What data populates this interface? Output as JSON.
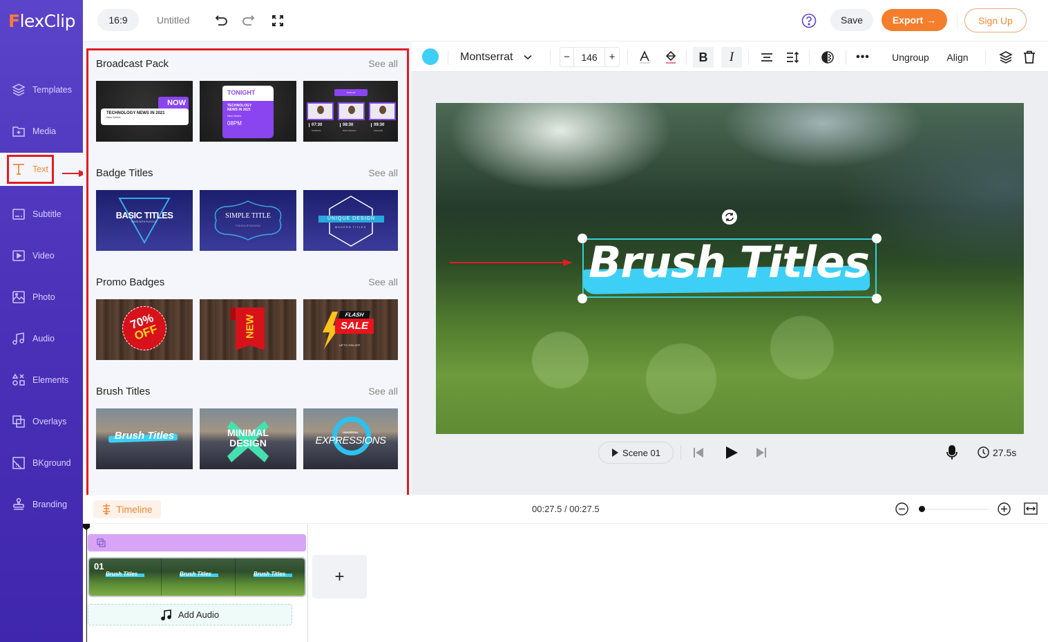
{
  "app": {
    "logo": "FlexClip",
    "aspect_ratio": "16:9",
    "project_title": "Untitled",
    "undo_icon": "undo-icon",
    "redo_icon": "redo-icon",
    "fullscreen_icon": "fullscreen-icon",
    "help_icon": "help-icon",
    "save_label": "Save",
    "export_label": "Export",
    "signup_label": "Sign Up",
    "accent": "#f47e2c",
    "sidebar_color": "#4a31b8"
  },
  "sidebar": {
    "items": [
      {
        "label": "Templates",
        "icon": "layers-icon"
      },
      {
        "label": "Media",
        "icon": "folder-plus-icon"
      },
      {
        "label": "Text",
        "icon": "text-icon",
        "active": true
      },
      {
        "label": "Subtitle",
        "icon": "subtitle-icon"
      },
      {
        "label": "Video",
        "icon": "video-icon"
      },
      {
        "label": "Photo",
        "icon": "photo-icon"
      },
      {
        "label": "Audio",
        "icon": "music-icon"
      },
      {
        "label": "Elements",
        "icon": "shapes-icon"
      },
      {
        "label": "Overlays",
        "icon": "overlays-icon"
      },
      {
        "label": "BKground",
        "icon": "background-icon"
      },
      {
        "label": "Branding",
        "icon": "stamp-icon"
      }
    ]
  },
  "panel": {
    "see_all": "See all",
    "sections": [
      {
        "title": "Broadcast Pack",
        "thumbs": [
          {
            "main": "TECHNOLOGY NEWS IN 2021",
            "sub": "New Series",
            "badge": "NOW"
          },
          {
            "head": "TONIGHT",
            "main": "TECHNOLOGY NEWS IN 2021",
            "sub": "New Series",
            "time": "08PM"
          },
          {
            "head": "TONIGHT",
            "times": [
              "07:30",
              "08:30",
              "09:30"
            ],
            "labels": [
              "SCIENCE",
              "WILD WORLD",
              "FASHION"
            ]
          }
        ]
      },
      {
        "title": "Badge Titles",
        "thumbs": [
          {
            "main": "BASIC TITLES",
            "sub": "MADE WITH FLEXCLIP"
          },
          {
            "main": "SIMPLE TITLE",
            "sub": "FLEXCLIP DESIGN"
          },
          {
            "main": "UNIQUE DESIGN",
            "sub": "MODERN TITLES"
          }
        ]
      },
      {
        "title": "Promo Badges",
        "thumbs": [
          {
            "main": "70%",
            "sub": "OFF"
          },
          {
            "main": "NEW"
          },
          {
            "head": "FLASH",
            "main": "SALE",
            "sub": "UP TO 70% OFF"
          }
        ]
      },
      {
        "title": "Brush Titles",
        "thumbs": [
          {
            "main": "Brush Titles"
          },
          {
            "main": "MINIMAL",
            "sub": "DESIGN"
          },
          {
            "head": "UNIVERSAL",
            "main": "EXPRESSIONS"
          }
        ]
      }
    ]
  },
  "toolbar": {
    "text_color": "#3dcff5",
    "font": "Montserrat",
    "font_size": "146",
    "minus": "−",
    "plus": "+",
    "bold": "B",
    "italic": "I",
    "ungroup": "Ungroup",
    "align": "Align"
  },
  "canvas": {
    "text": "Brush Titles",
    "brush_color": "#3dcff5"
  },
  "player": {
    "scene": "Scene 01",
    "duration": "27.5s"
  },
  "timeline": {
    "label": "Timeline",
    "time": "00:27.5 / 00:27.5",
    "zoom_level": 0.0,
    "clip_number": "01",
    "clip_text": "Brush Titles",
    "add_audio": "Add Audio",
    "add_scene": "+"
  }
}
